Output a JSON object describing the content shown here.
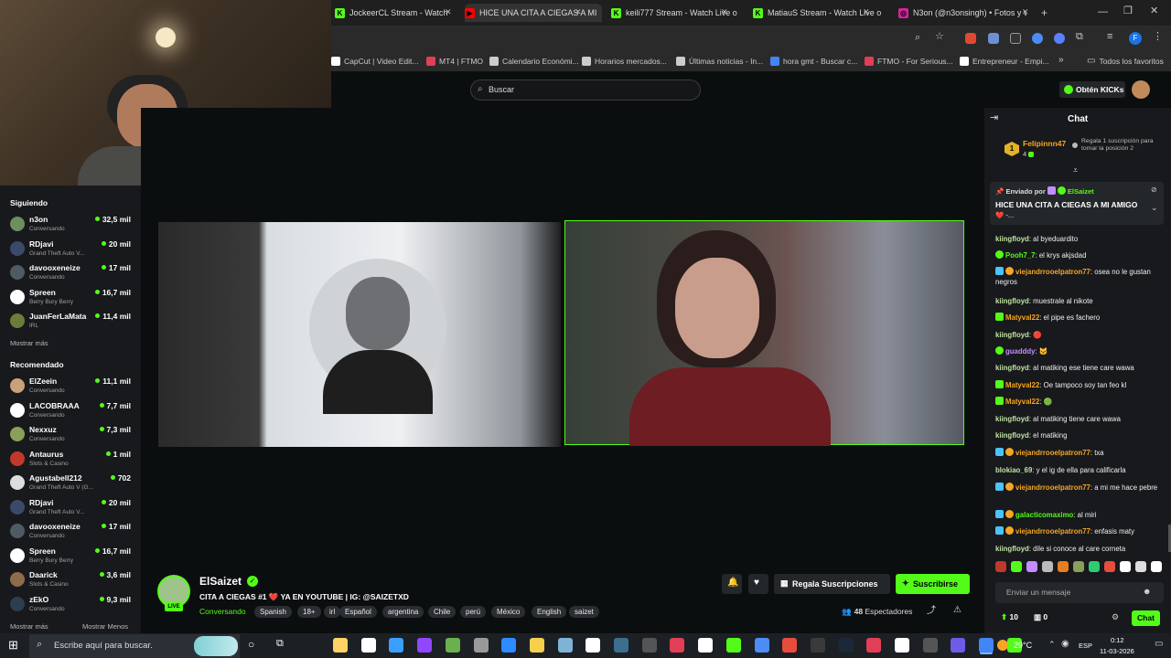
{
  "browser": {
    "tabs": [
      {
        "label": "JockeerCL Stream - Watch Live",
        "color": "#53fc18",
        "glyph": "K"
      },
      {
        "label": "HICE UNA CITA A CIEGAS A MI",
        "color": "#ff0000",
        "glyph": "▶"
      },
      {
        "label": "keili777 Stream - Watch Live o",
        "color": "#53fc18",
        "glyph": "K"
      },
      {
        "label": "MatiauS Stream - Watch Live o",
        "color": "#53fc18",
        "glyph": "K"
      },
      {
        "label": "N3on (@n3onsingh) • Fotos y v",
        "color": "#d6249f",
        "glyph": "◎"
      }
    ],
    "bookmarks": [
      {
        "label": "CapCut | Video Edit...",
        "color": "#ffffff"
      },
      {
        "label": "MT4 | FTMO",
        "color": "#e23e57"
      },
      {
        "label": "Calendario Económi...",
        "color": "#cccccc",
        "prefix": "Inv"
      },
      {
        "label": "Horarios mercados...",
        "color": "#cccccc",
        "prefix": "Inv"
      },
      {
        "label": "Últimas noticias - In...",
        "color": "#cccccc",
        "prefix": "Inv"
      },
      {
        "label": "hora gmt - Buscar c...",
        "color": "#4285f4"
      },
      {
        "label": "FTMO - For Serious...",
        "color": "#e23e57"
      },
      {
        "label": "Entrepreneur - Empi...",
        "color": "#ffffff",
        "prefix": "E"
      }
    ],
    "bookmarks_folder": "Todos los favoritos"
  },
  "header": {
    "search_placeholder": "Buscar",
    "kicks_button": "Obtén KICKs"
  },
  "sidebar": {
    "following_title": "Siguiendo",
    "following": [
      {
        "name": "n3on",
        "sub": "Conversando",
        "viewers": "32,5 mil",
        "color": "#6b8f5e"
      },
      {
        "name": "RDjavi",
        "sub": "Grand Theft Auto V...",
        "viewers": "20 mil",
        "color": "#3b4a6b"
      },
      {
        "name": "davooxeneize",
        "sub": "Conversando",
        "viewers": "17 mil",
        "color": "#4f5a63"
      },
      {
        "name": "Spreen",
        "sub": "Berry Bury Berry",
        "viewers": "16,7 mil",
        "color": "#ffffff"
      },
      {
        "name": "JuanFerLaMata",
        "sub": "IRL",
        "viewers": "11,4 mil",
        "color": "#6b7d3a"
      }
    ],
    "show_more": "Mostrar más",
    "recommended_title": "Recomendado",
    "recommended": [
      {
        "name": "ElZeein",
        "sub": "Conversando",
        "viewers": "11,1 mil",
        "color": "#c9a27a"
      },
      {
        "name": "LACOBRAAA",
        "sub": "Conversando",
        "viewers": "7,7 mil",
        "color": "#ffffff"
      },
      {
        "name": "Nexxuz",
        "sub": "Conversando",
        "viewers": "7,3 mil",
        "color": "#8aa05a"
      },
      {
        "name": "Antaurus",
        "sub": "Slots & Casino",
        "viewers": "1 mil",
        "color": "#c0392b"
      },
      {
        "name": "Agustabell212",
        "sub": "Grand Theft Auto V (G...",
        "viewers": "702",
        "color": "#dddddd"
      },
      {
        "name": "RDjavi",
        "sub": "Grand Theft Auto V...",
        "viewers": "20 mil",
        "color": "#3b4a6b"
      },
      {
        "name": "davooxeneize",
        "sub": "Conversando",
        "viewers": "17 mil",
        "color": "#4f5a63"
      },
      {
        "name": "Spreen",
        "sub": "Berry Bury Berry",
        "viewers": "16,7 mil",
        "color": "#ffffff"
      },
      {
        "name": "Daarick",
        "sub": "Slots & Casino",
        "viewers": "3,6 mil",
        "color": "#8e6b4a"
      },
      {
        "name": "zEkO",
        "sub": "Conversando",
        "viewers": "9,3 mil",
        "color": "#2c3e50"
      }
    ],
    "show_more2": "Mostrar más",
    "show_less": "Mostrar Menos"
  },
  "stream": {
    "channel": "ElSaizet",
    "live_badge": "LIVE",
    "title": "CITA A CIEGAS #1 ❤️ YA EN YOUTUBE  | IG: @SAIZETXD",
    "category": "Conversando",
    "tags": [
      "Spanish",
      "18+",
      "irl",
      "Español",
      "argentina",
      "Chile",
      "perú",
      "México",
      "English",
      "saizet"
    ],
    "gift_button": "Regala Suscripciones",
    "subscribe_button": "Suscribirse",
    "viewers": "48",
    "viewers_label": "Espectadores"
  },
  "chat": {
    "title": "Chat",
    "top_gifter": {
      "rank": "1",
      "name": "Felipinnn47",
      "count": "4",
      "note": "Regala 1 suscripción para tomar la posición 2"
    },
    "pinned": {
      "by_label": "Enviado por",
      "by": "ElSaizet",
      "text": "HICE UNA CITA A CIEGAS A MI AMIGO",
      "text2": "❤️ -..."
    },
    "messages": [
      {
        "user": "kiingfloyd",
        "color": "#bfe3a3",
        "text": "al byeduardito"
      },
      {
        "user": "Pooh7_7",
        "color": "#53fc18",
        "text": "el krys akjsdad"
      },
      {
        "user": "viejandrrooelpatron77",
        "color": "#f5a623",
        "text": "osea no le gustan negros"
      },
      {
        "user": "kiingfloyd",
        "color": "#bfe3a3",
        "text": "muestrale al nikote"
      },
      {
        "user": "Matyval22",
        "color": "#f5a623",
        "text": "el pipe es fachero"
      },
      {
        "user": "kiingfloyd",
        "color": "#bfe3a3",
        "text": "🔴"
      },
      {
        "user": "guadddy",
        "color": "#c58cff",
        "text": "🐱"
      },
      {
        "user": "kiingfloyd",
        "color": "#bfe3a3",
        "text": "al matiking ese tiene care wawa"
      },
      {
        "user": "Matyval22",
        "color": "#f5a623",
        "text": "Oe tampoco soy tan feo kl"
      },
      {
        "user": "Matyval22",
        "color": "#f5a623",
        "text": "🟢"
      },
      {
        "user": "kiingfloyd",
        "color": "#bfe3a3",
        "text": "al matiking tiene care wawa"
      },
      {
        "user": "kiingfloyd",
        "color": "#bfe3a3",
        "text": "el matiking"
      },
      {
        "user": "viejandrrooelpatron77",
        "color": "#f5a623",
        "text": "txa"
      },
      {
        "user": "blokiao_69",
        "color": "#bfe3a3",
        "text": "y el ig de ella para calificarla"
      },
      {
        "user": "viejandrrooelpatron77",
        "color": "#f5a623",
        "text": "a mi me hace pebre"
      },
      {
        "user": "galacticomaximo",
        "color": "#53fc18",
        "text": "al miri"
      },
      {
        "user": "viejandrrooelpatron77",
        "color": "#f5a623",
        "text": "enfasis maty"
      },
      {
        "user": "kiingfloyd",
        "color": "#bfe3a3",
        "text": "dile si conoce al care corneta"
      }
    ],
    "input_placeholder": "Enviar un mensaje",
    "points": "10",
    "gifts": "0",
    "send_button": "Chat"
  },
  "taskbar": {
    "search_placeholder": "Escribe aquí para buscar.",
    "temperature": "29°C",
    "language": "ESP",
    "time": "0:12",
    "date": "11-03-2026"
  }
}
